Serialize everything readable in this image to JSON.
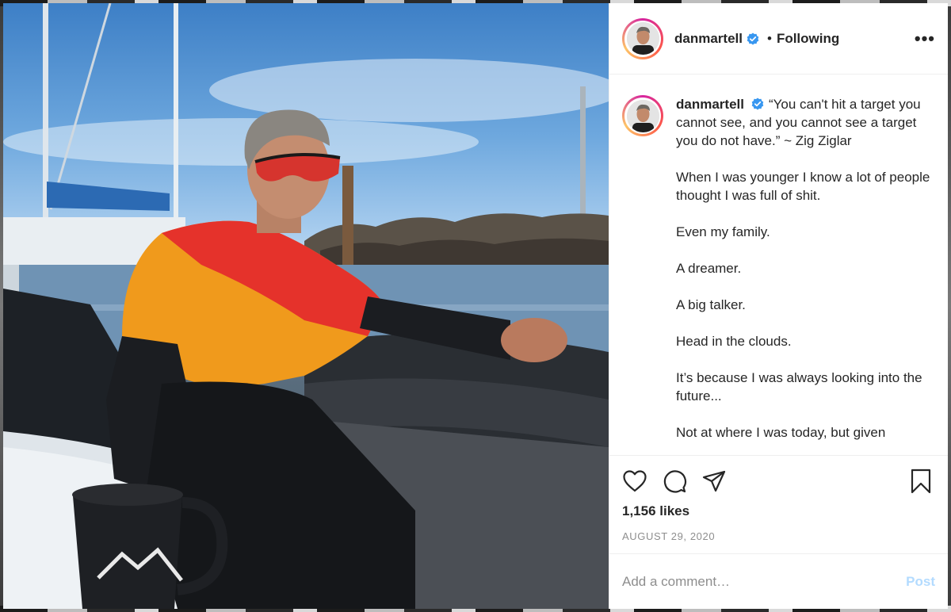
{
  "post": {
    "username": "danmartell",
    "verified": true,
    "follow_status": "Following",
    "separator": "•",
    "more_label": "•••",
    "caption": [
      "“You can't hit a target you cannot see, and you cannot see a target you do not have.” ~ Zig Ziglar",
      "When I was younger I know a lot of people thought I was full of shit.",
      "Even my family.",
      "A dreamer.",
      "A big talker.",
      "Head in the clouds.",
      "It’s because I was always looking into the future...",
      "Not at where I was today, but given"
    ],
    "likes": "1,156 likes",
    "date": "AUGUST 29, 2020"
  },
  "comment": {
    "placeholder": "Add a comment…",
    "post_label": "Post"
  },
  "icons": {
    "like": "heart-icon",
    "comment": "comment-icon",
    "share": "share-icon",
    "save": "bookmark-icon",
    "verified": "verified-badge-icon"
  },
  "colors": {
    "verified_blue": "#3897f0",
    "post_disabled": "#b3dbff",
    "muted_text": "#8e8e8e"
  }
}
